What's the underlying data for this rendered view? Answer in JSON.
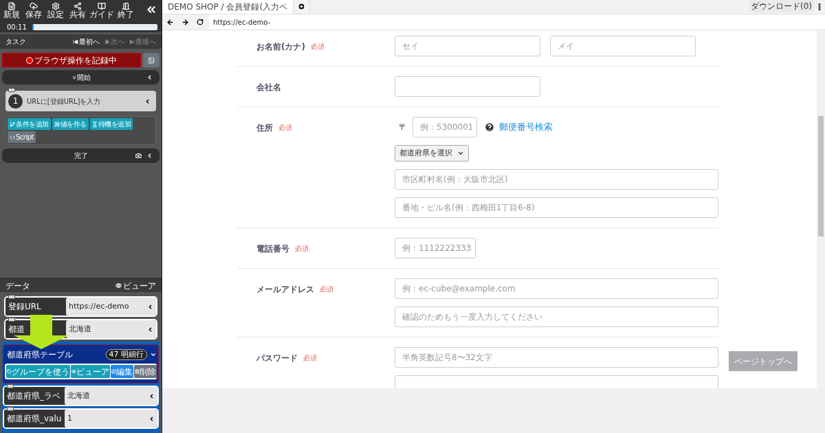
{
  "toolbar": {
    "buttons": [
      "新規",
      "保存",
      "設定",
      "共有",
      "ガイド",
      "終了"
    ],
    "timer": "00:11",
    "progress": {
      "level": 0.01
    }
  },
  "task": {
    "title": "タスク",
    "nav": [
      {
        "label": "最初へ",
        "disabled": false
      },
      {
        "label": "次へ",
        "disabled": true
      },
      {
        "label": "最後へ",
        "disabled": true
      }
    ],
    "record_button": "ブラウザ操作を記録中",
    "start": "開始",
    "steps": [
      {
        "number": "1",
        "label": "URLに[登録URL]を入力"
      }
    ],
    "actions": [
      "条件を追加",
      "値を作る",
      "待機を追加",
      "Script"
    ],
    "end": "完了"
  },
  "data": {
    "title": "データ",
    "viewer": "ビューア",
    "items": [
      {
        "kind": "field",
        "name": "登録URL",
        "value": "https://ec-demo"
      },
      {
        "kind": "field",
        "name": "都道",
        "value": "北海道"
      },
      {
        "kind": "group",
        "name": "都道府県テーブル",
        "badge": "47 明細行",
        "actions": [
          "グループを使う",
          "ビューア",
          "編集",
          "削除"
        ]
      },
      {
        "kind": "field",
        "name": "都道府県_ラベ",
        "value": "北海道"
      },
      {
        "kind": "field",
        "name": "都道府県_valu",
        "value": "1"
      }
    ]
  },
  "browser": {
    "tabs": [
      {
        "label": "DEMO SHOP / 会員登録(入力ペ",
        "selected": true
      }
    ],
    "download": "ダウンロード(0)",
    "url": "https://ec-demo-",
    "form": [
      {
        "label": "お名前(カナ)",
        "required": "必須",
        "fields": [
          {
            "kind": "short",
            "placeholder": "セイ"
          },
          {
            "kind": "short",
            "placeholder": "メイ"
          }
        ]
      },
      {
        "label": "会社名",
        "fields": [
          {
            "kind": "short"
          }
        ]
      },
      {
        "label": "住所",
        "required": "必須",
        "fields": [
          {
            "kind": "zip",
            "mark": "〒",
            "placeholder": "例：5300001",
            "link": "郵便番号検索"
          },
          {
            "kind": "select",
            "value": "都道府県を選択"
          },
          {
            "kind": "long",
            "placeholder": "市区町村名(例：大阪市北区)"
          },
          {
            "kind": "long",
            "placeholder": "番地・ビル名(例：西梅田1丁目6-8)"
          }
        ]
      },
      {
        "label": "電話番号",
        "required": "必須",
        "fields": [
          {
            "kind": "tiny",
            "placeholder": "例：1112222333"
          }
        ]
      },
      {
        "label": "メールアドレス",
        "required": "必須",
        "fields": [
          {
            "kind": "long",
            "placeholder": "例：ec-cube@example.com"
          },
          {
            "kind": "long",
            "placeholder": "確認のためもう一度入力してください"
          }
        ]
      },
      {
        "label": "パスワード",
        "required": "必須",
        "fields": [
          {
            "kind": "long",
            "placeholder": "半角英数記号8〜32文字"
          },
          {
            "kind": "long"
          }
        ]
      }
    ],
    "page_top": "ページトップへ"
  }
}
